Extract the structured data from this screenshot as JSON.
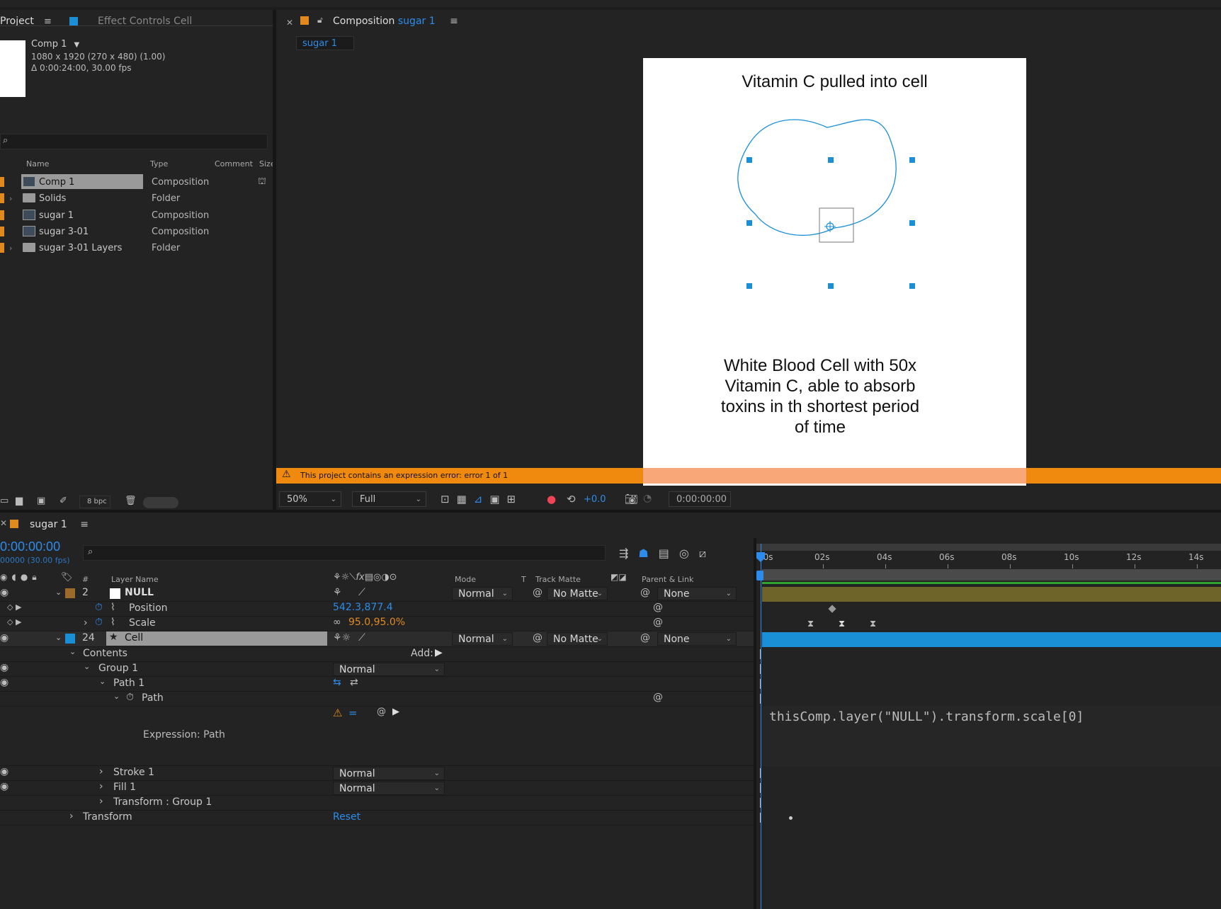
{
  "project_panel": {
    "tab_project": "Project",
    "tab_effect_controls": "Effect Controls Cell",
    "comp_title": "Comp 1",
    "comp_info_1": "1080 x 1920  (270 x 480) (1.00)",
    "comp_info_2": "Δ 0:00:24:00, 30.00 fps",
    "columns": [
      "Name",
      "Type",
      "Comment",
      "Size"
    ],
    "items": [
      {
        "name": "Comp 1",
        "type": "Composition",
        "kind": "comp",
        "label_color": "#e08a1e"
      },
      {
        "name": "Solids",
        "type": "Folder",
        "kind": "folder",
        "label_color": "#e08a1e"
      },
      {
        "name": "sugar 1",
        "type": "Composition",
        "kind": "comp",
        "label_color": "#e08a1e"
      },
      {
        "name": "sugar 3-01",
        "type": "Composition",
        "kind": "comp",
        "label_color": "#e08a1e"
      },
      {
        "name": "sugar 3-01 Layers",
        "type": "Folder",
        "kind": "folder",
        "label_color": "#e08a1e"
      }
    ],
    "bpc": "8 bpc"
  },
  "comp_panel": {
    "tab_label": "Composition",
    "tab_comp_name": "sugar 1",
    "sub_tab": "sugar 1",
    "canvas_title": "Vitamin C pulled into cell",
    "canvas_caption_lines": [
      "White Blood Cell with 50x",
      "Vitamin C, able to absorb",
      "toxins in th shortest period",
      "of time"
    ],
    "error_text": "This project contains an expression error: error 1 of 1",
    "zoom": "50%",
    "resolution": "Full",
    "exposure": "+0.0",
    "timecode": "0:00:00:00"
  },
  "timeline": {
    "tab_label": "sugar 1",
    "current_time": "0:00:00:00",
    "frame_info": "00000 (30.00 fps)",
    "ruler_labels": [
      "00s",
      "02s",
      "04s",
      "06s",
      "08s",
      "10s",
      "12s",
      "14s"
    ],
    "col_headers": {
      "num": "#",
      "layer_name": "Layer Name",
      "mode": "Mode",
      "t": "T",
      "track_matte": "Track Matte",
      "parent": "Parent & Link"
    },
    "layers": [
      {
        "num": "2",
        "name": "NULL",
        "mode": "Normal",
        "matte": "No Matte",
        "parent": "None",
        "label_color": "#9c6b2c"
      },
      {
        "num": "24",
        "name": "Cell",
        "mode": "Normal",
        "matte": "No Matte",
        "parent": "None",
        "label_color": "#1a8fd6"
      }
    ],
    "null_props": {
      "position_label": "Position",
      "position_value": "542.3,877.4",
      "scale_label": "Scale",
      "scale_value": "95.0,95.0%"
    },
    "cell_props": {
      "contents": "Contents",
      "add": "Add:",
      "group1": "Group 1",
      "group1_mode": "Normal",
      "path1": "Path 1",
      "path": "Path",
      "expression_label": "Expression: Path",
      "expression_code": "thisComp.layer(\"NULL\").transform.scale[0]",
      "stroke1": "Stroke 1",
      "stroke1_mode": "Normal",
      "fill1": "Fill 1",
      "fill1_mode": "Normal",
      "transform_group": "Transform : Group 1",
      "transform": "Transform",
      "reset": "Reset"
    }
  }
}
